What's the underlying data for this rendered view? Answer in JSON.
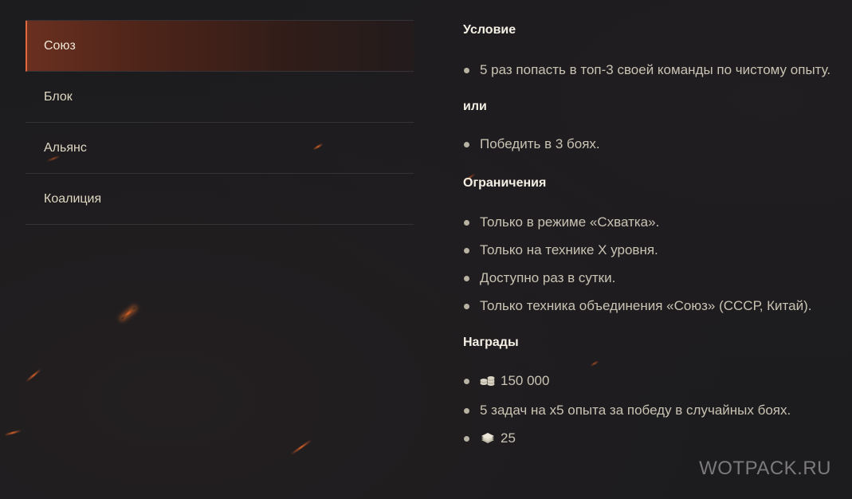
{
  "sidebar": {
    "tabs": [
      {
        "label": "Союз",
        "active": true
      },
      {
        "label": "Блок",
        "active": false
      },
      {
        "label": "Альянс",
        "active": false
      },
      {
        "label": "Коалиция",
        "active": false
      }
    ]
  },
  "content": {
    "condition_heading": "Условие",
    "condition_items": [
      "5 раз попасть в топ-3 своей команды по чистому опыту."
    ],
    "or_heading": "или",
    "or_items": [
      "Победить в 3 боях."
    ],
    "restrictions_heading": "Ограничения",
    "restrictions_items": [
      "Только в режиме «Схватка».",
      "Только на технике X уровня.",
      "Доступно раз в сутки.",
      "Только техника объединения «Союз» (СССР, Китай)."
    ],
    "rewards_heading": "Награды",
    "rewards": {
      "credits": {
        "icon": "credits-icon",
        "value": "150 000"
      },
      "tasks": "5 задач на х5 опыта за победу в случайных боях.",
      "bonds": {
        "icon": "bonds-icon",
        "value": "25"
      }
    }
  },
  "watermark": "WOTPACK.RU",
  "colors": {
    "accent": "#e26a3c",
    "background": "#1d1c1f",
    "text": "#c9c3b4",
    "heading": "#f4efe4"
  }
}
